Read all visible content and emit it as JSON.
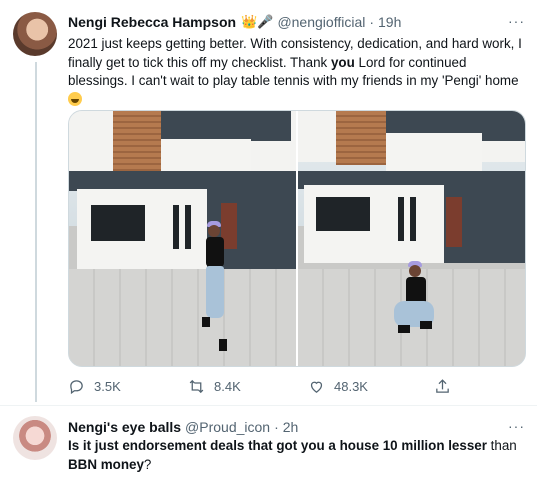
{
  "tweet": {
    "author_name": "Nengi Rebecca Hampson",
    "badges": "👑🎤",
    "handle": "@nengiofficial",
    "dot": "·",
    "time": "19h",
    "more": "···",
    "text_part1": "2021 just keeps getting better. With consistency, dedication, and hard work, I finally get to tick this off my checklist. Thank ",
    "text_bold": "you",
    "text_part2": " Lord for continued blessings. I can't wait to play table tennis with my friends in my 'Pengi' home",
    "images": [
      "photo-left",
      "photo-right"
    ],
    "actions": {
      "reply_count": "3.5K",
      "retweet_count": "8.4K",
      "like_count": "48.3K"
    }
  },
  "reply": {
    "author_name": "Nengi's eye balls",
    "handle": "@Proud_icon",
    "dot": "·",
    "time": "2h",
    "more": "···",
    "text_bold": "Is it just endorsement deals that got you a house 10 million lesser",
    "text_mid": " than ",
    "text_bold2": "BBN money",
    "text_end": "?"
  },
  "icons": [
    "reply-icon",
    "retweet-icon",
    "like-icon",
    "share-icon",
    "more-icon"
  ],
  "colors": {
    "text": "#0f1419",
    "secondary": "#536471",
    "border": "#cfd9de"
  }
}
